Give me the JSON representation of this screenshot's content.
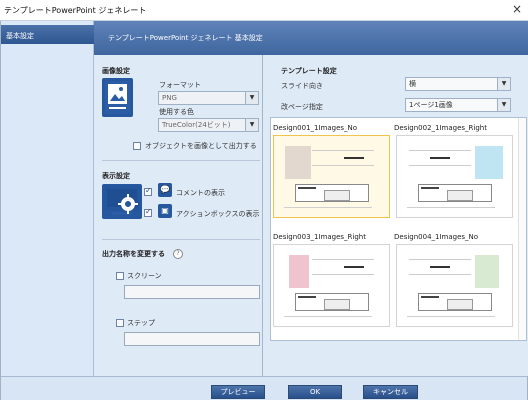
{
  "window": {
    "title": "テンプレートPowerPoint ジェネレート",
    "close_label": "×"
  },
  "sidebar": {
    "items": [
      {
        "label": "基本設定"
      }
    ]
  },
  "header": {
    "title": "テンプレートPowerPoint ジェネレート 基本設定"
  },
  "image_settings": {
    "section_title": "画像設定",
    "format_label": "フォーマット",
    "format_value": "PNG",
    "color_label": "使用する色",
    "color_value": "TrueColor(24ビット)",
    "output_object_label": "オブジェクトを画像として出力する"
  },
  "display_settings": {
    "section_title": "表示設定",
    "comment_label": "コメントの表示",
    "actionbox_label": "アクションボックスの表示"
  },
  "output_name": {
    "section_title": "出力名称を変更する",
    "help_label": "?",
    "screen_label": "スクリーン",
    "step_label": "ステップ"
  },
  "template_settings": {
    "section_title": "テンプレート設定",
    "orientation_label": "スライド向き",
    "orientation_value": "横",
    "page_label": "改ページ指定",
    "page_value": "1ページ1画像",
    "designs": [
      {
        "name": "Design001_1Images_No",
        "accent": "#e2d8d0"
      },
      {
        "name": "Design002_1Images_Right",
        "accent": "#bfe4f2"
      },
      {
        "name": "Design003_1Images_Right",
        "accent": "#efc4ce"
      },
      {
        "name": "Design004_1Images_No",
        "accent": "#d8ead1"
      }
    ]
  },
  "footer": {
    "preview_label": "プレビュー",
    "ok_label": "OK",
    "cancel_label": "キャンセル"
  }
}
